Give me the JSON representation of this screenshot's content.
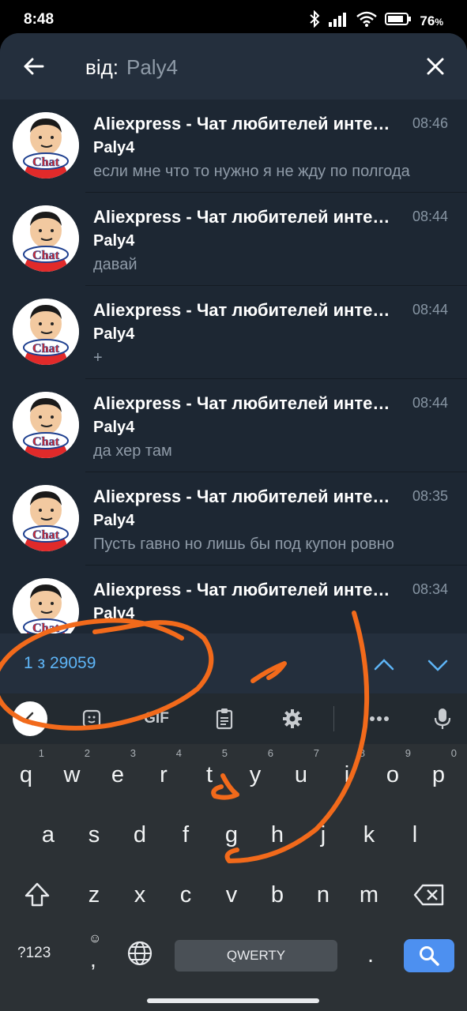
{
  "status_bar": {
    "time": "8:48",
    "battery": "76"
  },
  "search": {
    "prefix": "від:",
    "query": "Paly4"
  },
  "results": [
    {
      "title": "Aliexpress - Чат любителей интересных покупок",
      "time": "08:46",
      "sender": "Paly4",
      "message": "если мне что то нужно я не жду по полгода"
    },
    {
      "title": "Aliexpress - Чат любителей интересных покупок",
      "time": "08:44",
      "sender": "Paly4",
      "message": "давай"
    },
    {
      "title": "Aliexpress - Чат любителей интересных покупок",
      "time": "08:44",
      "sender": "Paly4",
      "message": "+"
    },
    {
      "title": "Aliexpress - Чат любителей интересных покупок",
      "time": "08:44",
      "sender": "Paly4",
      "message": "да хер там"
    },
    {
      "title": "Aliexpress - Чат любителей интересных покупок",
      "time": "08:35",
      "sender": "Paly4",
      "message": "Пусть гавно но лишь бы под купон ровно"
    },
    {
      "title": "Aliexpress - Чат любителей интересных покупок",
      "time": "08:34",
      "sender": "Paly4",
      "message": ""
    }
  ],
  "avatar_text": "Chat",
  "navigation": {
    "counter": "1 з 29059"
  },
  "keyboard": {
    "toolbar": {
      "gif": "GIF"
    },
    "row1": [
      {
        "key": "q",
        "hint": "1"
      },
      {
        "key": "w",
        "hint": "2"
      },
      {
        "key": "e",
        "hint": "3"
      },
      {
        "key": "r",
        "hint": "4"
      },
      {
        "key": "t",
        "hint": "5"
      },
      {
        "key": "y",
        "hint": "6"
      },
      {
        "key": "u",
        "hint": "7"
      },
      {
        "key": "i",
        "hint": "8"
      },
      {
        "key": "o",
        "hint": "9"
      },
      {
        "key": "p",
        "hint": "0"
      }
    ],
    "row2": [
      "a",
      "s",
      "d",
      "f",
      "g",
      "h",
      "j",
      "k",
      "l"
    ],
    "row3": [
      "z",
      "x",
      "c",
      "v",
      "b",
      "n",
      "m"
    ],
    "symbols_label": "?123",
    "comma": ",",
    "period": ".",
    "space_label": "QWERTY"
  },
  "colors": {
    "app_bg": "#1d2733",
    "header_bg": "#242f3d",
    "accent": "#5eb5f7",
    "scribble": "#f26a1b",
    "enter_key": "#4d90f0"
  }
}
